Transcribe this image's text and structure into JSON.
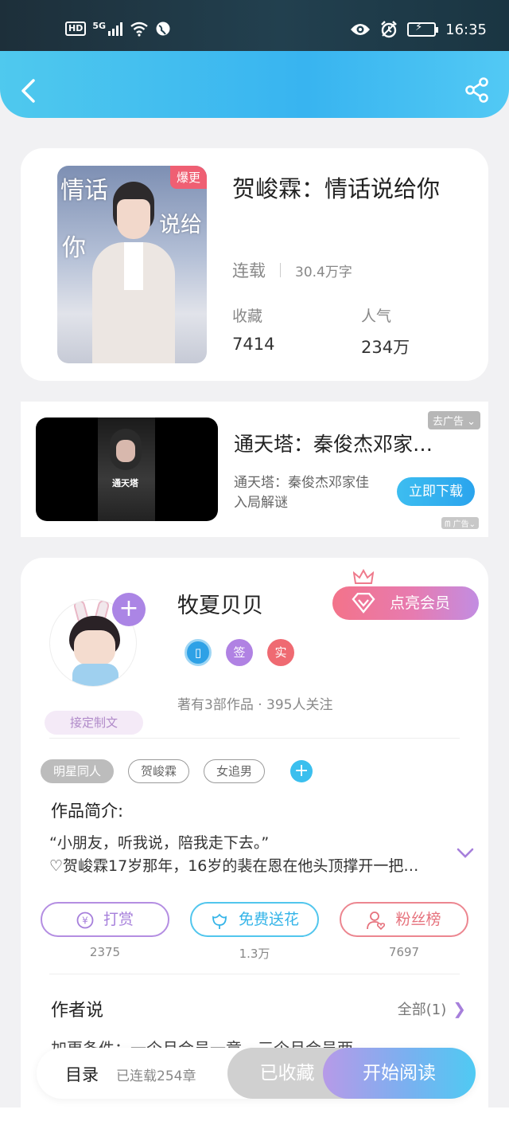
{
  "status_bar": {
    "hd": "HD",
    "network": "5G",
    "time": "16:35",
    "icons": [
      "signal-icon",
      "wifi-icon",
      "globe-icon",
      "eye-icon",
      "alarm-icon",
      "battery-icon"
    ]
  },
  "book": {
    "title": "贺峻霖：情话说给你",
    "cover_text_1": "情话",
    "cover_text_2": "说给",
    "cover_text_3": "你",
    "hot_badge": "爆更",
    "status": "连载",
    "word_count": "30.4万字",
    "favorites_label": "收藏",
    "favorites_value": "7414",
    "popularity_label": "人气",
    "popularity_value": "234万"
  },
  "ad": {
    "title": "通天塔：秦俊杰邓家佳入局解谜",
    "description": "通天塔：秦俊杰邓家佳入局解谜",
    "close_label": "去广告",
    "download_label": "立即下载",
    "ad_mark": "广告",
    "thumb_title": "通天塔"
  },
  "author": {
    "name": "牧夏贝贝",
    "vip_button": "点亮会员",
    "custom_tag": "接定制文",
    "badge_sign": "签",
    "badge_real": "实",
    "works_summary": "著有3部作品 · 395人关注"
  },
  "tags": [
    "明星同人",
    "贺峻霖",
    "女追男"
  ],
  "intro": {
    "heading": "作品简介:",
    "line1": "“小朋友，听我说，陪我走下去。”",
    "line2": "♡贺峻霖17岁那年，16岁的裴在恩在他头顶撑开一把…"
  },
  "actions": [
    {
      "label": "打赏",
      "count": "2375"
    },
    {
      "label": "免费送花",
      "count": "1.3万"
    },
    {
      "label": "粉丝榜",
      "count": "7697"
    }
  ],
  "author_says": {
    "heading": "作者说",
    "all_label": "全部(1)",
    "preview": "加更条件：一个月会员一章，三个月会员两"
  },
  "bottom_bar": {
    "toc_label": "目录",
    "chapter_info": "已连载254章",
    "favorited_label": "已收藏",
    "read_label": "开始阅读"
  },
  "colors": {
    "header_blue": "#38b4f0",
    "accent_purple": "#ab85e5",
    "accent_red": "#ef5f73"
  }
}
